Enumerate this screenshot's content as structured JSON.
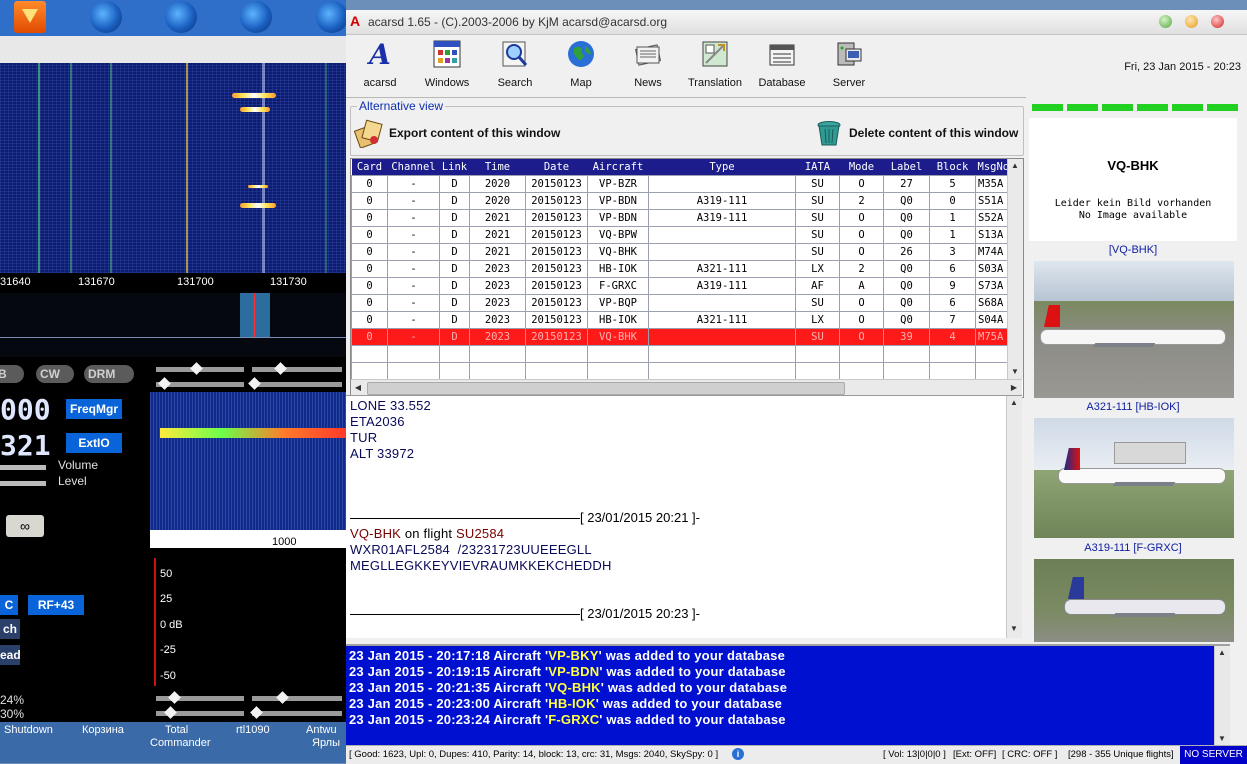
{
  "sdr": {
    "freq_ticks": [
      "31640",
      "131670",
      "131700",
      "131730"
    ],
    "modes": [
      "SB",
      "CW",
      "DRM"
    ],
    "digits_top": "000",
    "digits_bottom": "321",
    "freqmgr_label": "FreqMgr",
    "extio_label": "ExtIO",
    "volume_label": "Volume",
    "level_label": "Level",
    "rf_label": "RF+43",
    "left_btn1": "C",
    "left_btn2": "ch",
    "left_btn3": "ead",
    "pct1": "24%",
    "pct2": "30%",
    "small_scale_label": "1000",
    "meter_labels": [
      "50",
      "25",
      "0 dB",
      "-25",
      "-50"
    ]
  },
  "taskbar": [
    "Shutdown",
    "Корзина",
    "Total",
    "Commander",
    "rtl1090",
    "Antwu",
    "Ярлы"
  ],
  "window": {
    "title": "acarsd 1.65 - (C).2003-2006 by KjM acarsd@acarsd.org",
    "app_icon": "A",
    "datetime": "Fri, 23 Jan 2015 - 20:23"
  },
  "toolbar": [
    {
      "label": "acarsd",
      "icon": "acarsd-logo-icon"
    },
    {
      "label": "Windows",
      "icon": "windows-icon"
    },
    {
      "label": "Search",
      "icon": "search-icon"
    },
    {
      "label": "Map",
      "icon": "globe-icon"
    },
    {
      "label": "News",
      "icon": "news-icon"
    },
    {
      "label": "Translation",
      "icon": "translation-icon"
    },
    {
      "label": "Database",
      "icon": "database-icon"
    },
    {
      "label": "Server",
      "icon": "server-icon"
    }
  ],
  "altview": {
    "title": "Alternative view",
    "export_label": "Export content of this window",
    "delete_label": "Delete content of this window"
  },
  "table": {
    "headers": [
      "Card",
      "Channel",
      "Link",
      "Time",
      "Date",
      "Aircraft",
      "Type",
      "IATA",
      "Mode",
      "Label",
      "Block",
      "MsgNo"
    ],
    "rows": [
      [
        "0",
        "-",
        "D",
        "2020",
        "20150123",
        "VP-BZR",
        "",
        "SU",
        "O",
        "27",
        "5",
        "M35A"
      ],
      [
        "0",
        "-",
        "D",
        "2020",
        "20150123",
        "VP-BDN",
        "A319-111",
        "SU",
        "2",
        "Q0",
        "0",
        "S51A"
      ],
      [
        "0",
        "-",
        "D",
        "2021",
        "20150123",
        "VP-BDN",
        "A319-111",
        "SU",
        "O",
        "Q0",
        "1",
        "S52A"
      ],
      [
        "0",
        "-",
        "D",
        "2021",
        "20150123",
        "VQ-BPW",
        "",
        "SU",
        "O",
        "Q0",
        "1",
        "S13A"
      ],
      [
        "0",
        "-",
        "D",
        "2021",
        "20150123",
        "VQ-BHK",
        "",
        "SU",
        "O",
        "26",
        "3",
        "M74A"
      ],
      [
        "0",
        "-",
        "D",
        "2023",
        "20150123",
        "HB-IOK",
        "A321-111",
        "LX",
        "2",
        "Q0",
        "6",
        "S03A"
      ],
      [
        "0",
        "-",
        "D",
        "2023",
        "20150123",
        "F-GRXC",
        "A319-111",
        "AF",
        "A",
        "Q0",
        "9",
        "S73A"
      ],
      [
        "0",
        "-",
        "D",
        "2023",
        "20150123",
        "VP-BQP",
        "",
        "SU",
        "O",
        "Q0",
        "6",
        "S68A"
      ],
      [
        "0",
        "-",
        "D",
        "2023",
        "20150123",
        "HB-IOK",
        "A321-111",
        "LX",
        "O",
        "Q0",
        "7",
        "S04A"
      ],
      [
        "0",
        "-",
        "D",
        "2023",
        "20150123",
        "VQ-BHK",
        "",
        "SU",
        "O",
        "39",
        "4",
        "M75A"
      ]
    ],
    "selected_index": 9
  },
  "message": {
    "lines_top": [
      "LONE 33.552",
      "ETA2036",
      "TUR",
      "ALT 33972"
    ],
    "sep1": "[ 23/01/2015 20:21 ]-",
    "reg": "VQ-BHK",
    "on_flight": " on flight ",
    "flight": "SU2584",
    "body1": "WXR01AFL2584  /23231723UUEEEGLL",
    "body2": "MEGLLEGKKEYVIEVRAUMKKEKCHEDDH",
    "sep2": "[ 23/01/2015 20:23 ]-"
  },
  "log": [
    {
      "prefix": "23 Jan 2015 - 20:17:18 Aircraft '",
      "reg": "VP-BKY",
      "suffix": "' was added to your database"
    },
    {
      "prefix": "23 Jan 2015 - 20:19:15 Aircraft '",
      "reg": "VP-BDN",
      "suffix": "' was added to your database"
    },
    {
      "prefix": "23 Jan 2015 - 20:21:35 Aircraft '",
      "reg": "VQ-BHK",
      "suffix": "' was added to your database"
    },
    {
      "prefix": "23 Jan 2015 - 20:23:00 Aircraft '",
      "reg": "HB-IOK",
      "suffix": "' was added to your database"
    },
    {
      "prefix": "23 Jan 2015 - 20:23:24 Aircraft '",
      "reg": "F-GRXC",
      "suffix": "' was added to your database"
    }
  ],
  "status": {
    "stats": "[ Good: 1623, Upl: 0, Dupes: 410, Parity: 14, block: 13, crc: 31, Msgs: 2040, SkySpy: 0 ]",
    "vol": "[ Vol: 13|0|0|0 ]",
    "ext": "[Ext: OFF]",
    "crc": "[ CRC: OFF ]",
    "unique": "[298 - 355 Unique flights]",
    "server": "NO SERVER"
  },
  "images": {
    "card1_reg": "VQ-BHK",
    "card1_noimg_de": "Leider kein Bild vorhanden",
    "card1_noimg_en": "No Image available",
    "card1_caption": "[VQ-BHK]",
    "card2_caption": "A321-111 [HB-IOK]",
    "card3_caption": "A319-111 [F-GRXC]"
  },
  "colors": {
    "log_bg": "#0010d0",
    "selected_row": "#ff1a1a",
    "header_bg": "#1c1c8c",
    "level_green": "#21d021"
  }
}
